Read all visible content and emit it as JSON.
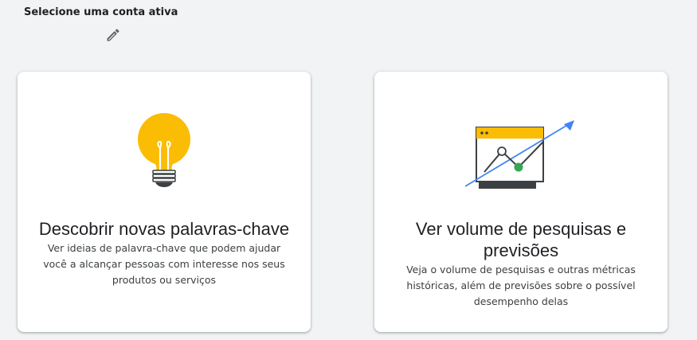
{
  "header": {
    "title": "Selecione uma conta ativa",
    "edit_icon": "pencil-icon"
  },
  "cards": [
    {
      "icon": "lightbulb-icon",
      "title": "Descobrir novas palavras-chave",
      "description": "Ver ideias de palavra-chave que podem ajudar você a alcançar pessoas com interesse nos seus produtos ou serviços"
    },
    {
      "icon": "trend-chart-icon",
      "title": "Ver volume de pesquisas e previsões",
      "description": "Veja o volume de pesquisas e outras métricas históricas, além de previsões sobre o possível desempenho delas"
    }
  ],
  "colors": {
    "background": "#f1f3f4",
    "bulb_yellow": "#fbbc04",
    "accent_blue": "#4285f4",
    "accent_green": "#34a853",
    "dark": "#3c4043"
  }
}
